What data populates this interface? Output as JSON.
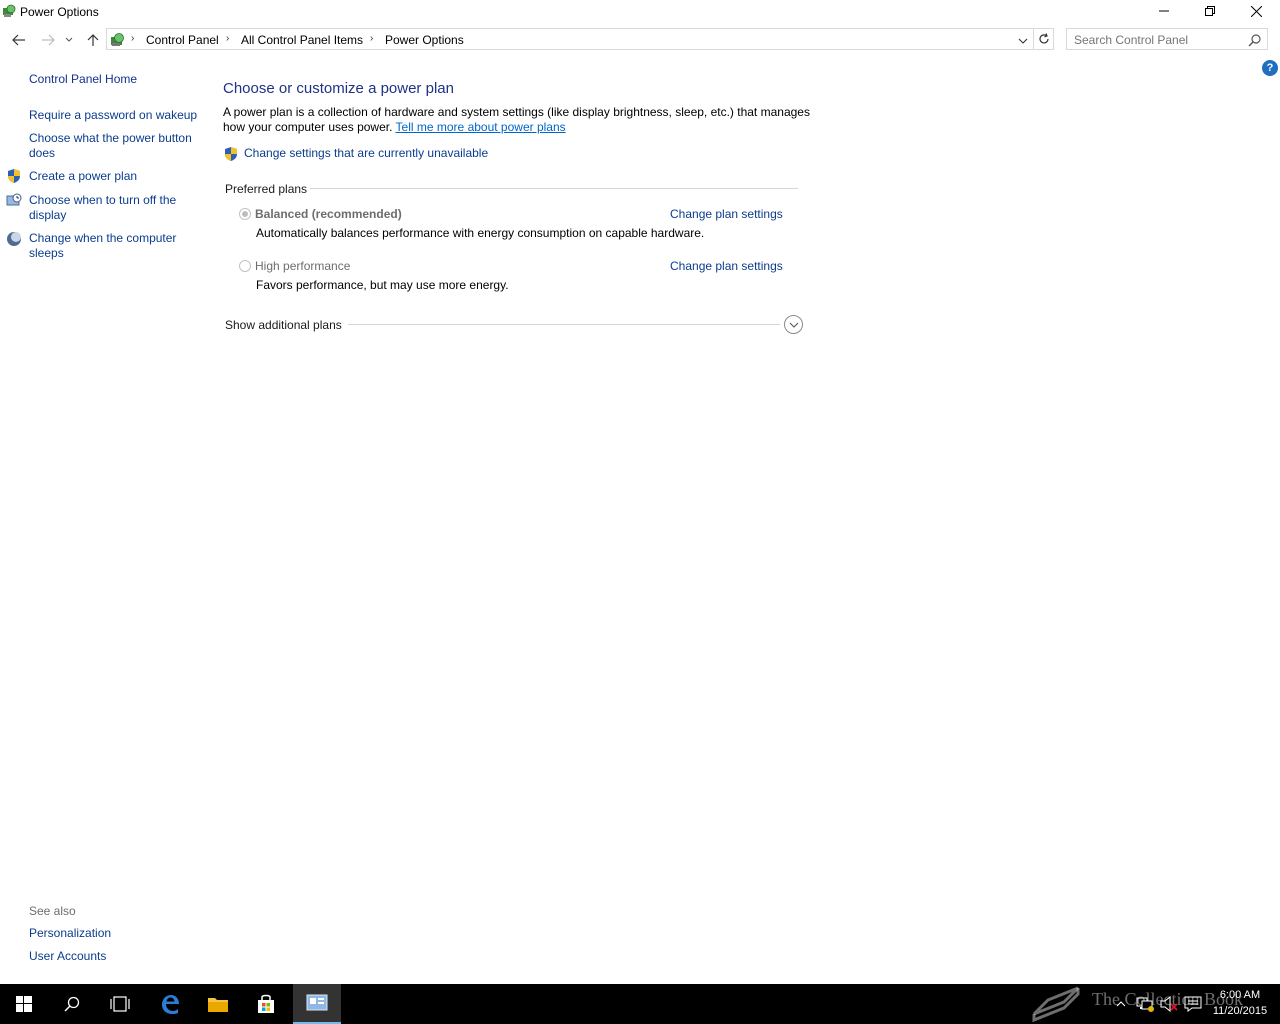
{
  "window": {
    "title": "Power Options"
  },
  "nav": {
    "breadcrumbs": [
      "Control Panel",
      "All Control Panel Items",
      "Power Options"
    ],
    "search_placeholder": "Search Control Panel"
  },
  "left_pane": {
    "home": "Control Panel Home",
    "links": [
      "Require a password on wakeup",
      "Choose what the power button does",
      "Create a power plan",
      "Choose when to turn off the display",
      "Change when the computer sleeps"
    ],
    "see_also_label": "See also",
    "see_also": [
      "Personalization",
      "User Accounts"
    ]
  },
  "main": {
    "title": "Choose or customize a power plan",
    "description": "A power plan is a collection of hardware and system settings (like display brightness, sleep, etc.) that manages how your computer uses power.",
    "learn_more_link": "Tell me more about power plans",
    "change_unavailable": "Change settings that are currently unavailable",
    "preferred_plans_label": "Preferred plans",
    "plans": [
      {
        "name": "Balanced (recommended)",
        "description": "Automatically balances performance with energy consumption on capable hardware.",
        "link": "Change plan settings",
        "selected": true
      },
      {
        "name": "High performance",
        "description": "Favors performance, but may use more energy.",
        "link": "Change plan settings",
        "selected": false
      }
    ],
    "show_additional": "Show additional plans"
  },
  "taskbar": {
    "time": "6:00 AM",
    "date": "11/20/2015",
    "watermark": "The Collection Book"
  },
  "colors": {
    "link": "#0b3c8e",
    "title": "#1e3287",
    "taskbar": "#000000",
    "active_task": "#76b9ed"
  }
}
